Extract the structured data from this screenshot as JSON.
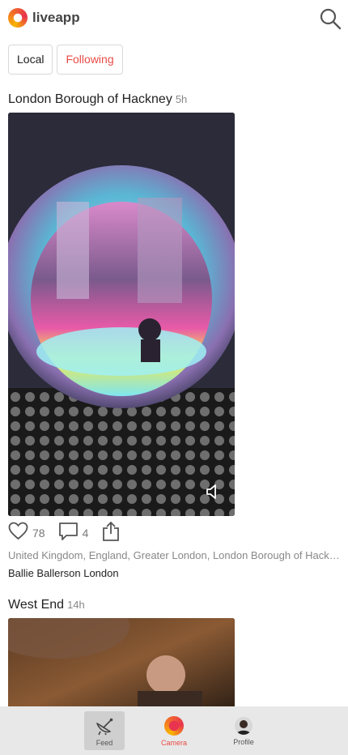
{
  "app": {
    "brand": "liveapp"
  },
  "tabs": [
    {
      "label": "Local"
    },
    {
      "label": "Following"
    }
  ],
  "posts": [
    {
      "title": "London Borough of Hackney",
      "time": "5h",
      "likes": "78",
      "comments": "4",
      "location": "United Kingdom, England, Greater London, London Borough of Hackney",
      "venue": "Ballie Ballerson London"
    },
    {
      "title": "West End",
      "time": "14h"
    }
  ],
  "nav": {
    "feed": "Feed",
    "camera": "Camera",
    "profile": "Profile"
  },
  "colors": {
    "accent": "#e94b47",
    "nav_bg": "#e8e8e8"
  },
  "icons": {
    "search": "search-icon",
    "like": "heart-icon",
    "comment": "comment-icon",
    "share": "share-icon",
    "mute": "speaker-muted-icon",
    "feed": "satellite-dish-icon",
    "camera": "camera-record-icon",
    "profile": "avatar"
  }
}
